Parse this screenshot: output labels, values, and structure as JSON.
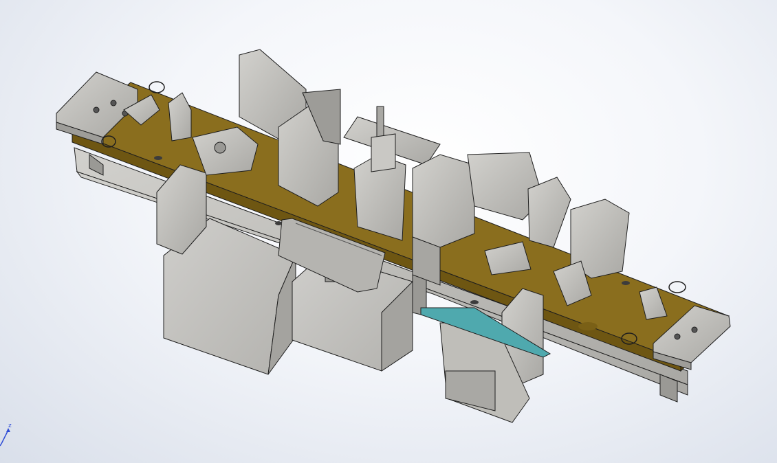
{
  "viewport": {
    "background_top": "#ffffff",
    "background_bottom": "#d9dfea"
  },
  "model": {
    "plate_color": "#8a6e1e",
    "plate_top_color": "#7f6418",
    "metal_color": "#bdbcb8",
    "metal_dark": "#8e8d8a",
    "enclosure_color": "#c4c3bf",
    "accent_teal": "#4fa9ae",
    "edge_color": "#1e1e1e"
  },
  "triad": {
    "axis_label": "z",
    "axis_color": "#2d4bd6"
  }
}
